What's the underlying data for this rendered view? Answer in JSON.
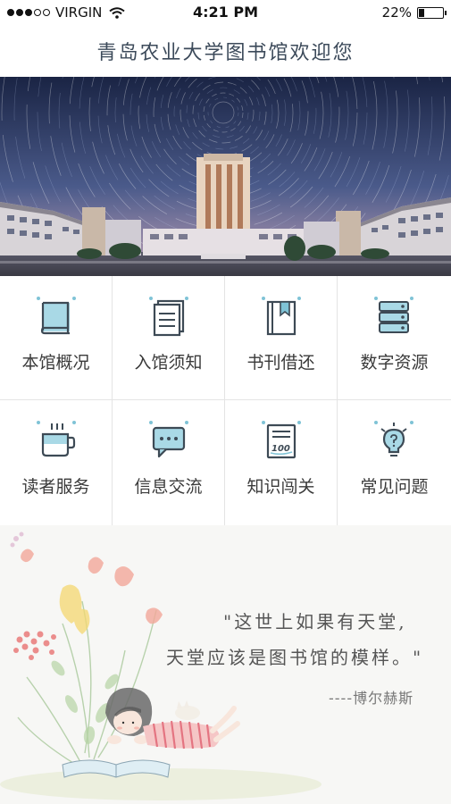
{
  "status_bar": {
    "carrier": "VIRGIN",
    "time": "4:21 PM",
    "battery": "22%",
    "battery_level": 0.22
  },
  "header": {
    "title": "青岛农业大学图书馆欢迎您"
  },
  "menu": {
    "items": [
      {
        "label": "本馆概况",
        "icon": "book-icon"
      },
      {
        "label": "入馆须知",
        "icon": "document-icon"
      },
      {
        "label": "书刊借还",
        "icon": "bookmark-book-icon"
      },
      {
        "label": "数字资源",
        "icon": "server-icon"
      },
      {
        "label": "读者服务",
        "icon": "coffee-cup-icon"
      },
      {
        "label": "信息交流",
        "icon": "chat-bubble-icon"
      },
      {
        "label": "知识闯关",
        "icon": "score-paper-icon"
      },
      {
        "label": "常见问题",
        "icon": "lightbulb-icon"
      }
    ],
    "score_text": "100"
  },
  "quote": {
    "line1": "\"这世上如果有天堂,",
    "line2": "天堂应该是图书馆的模样。\"",
    "author": "----博尔赫斯"
  },
  "colors": {
    "icon_accent": "#7fc3d6",
    "icon_stroke": "#3d4a55",
    "title_text": "#3c4a5a"
  }
}
